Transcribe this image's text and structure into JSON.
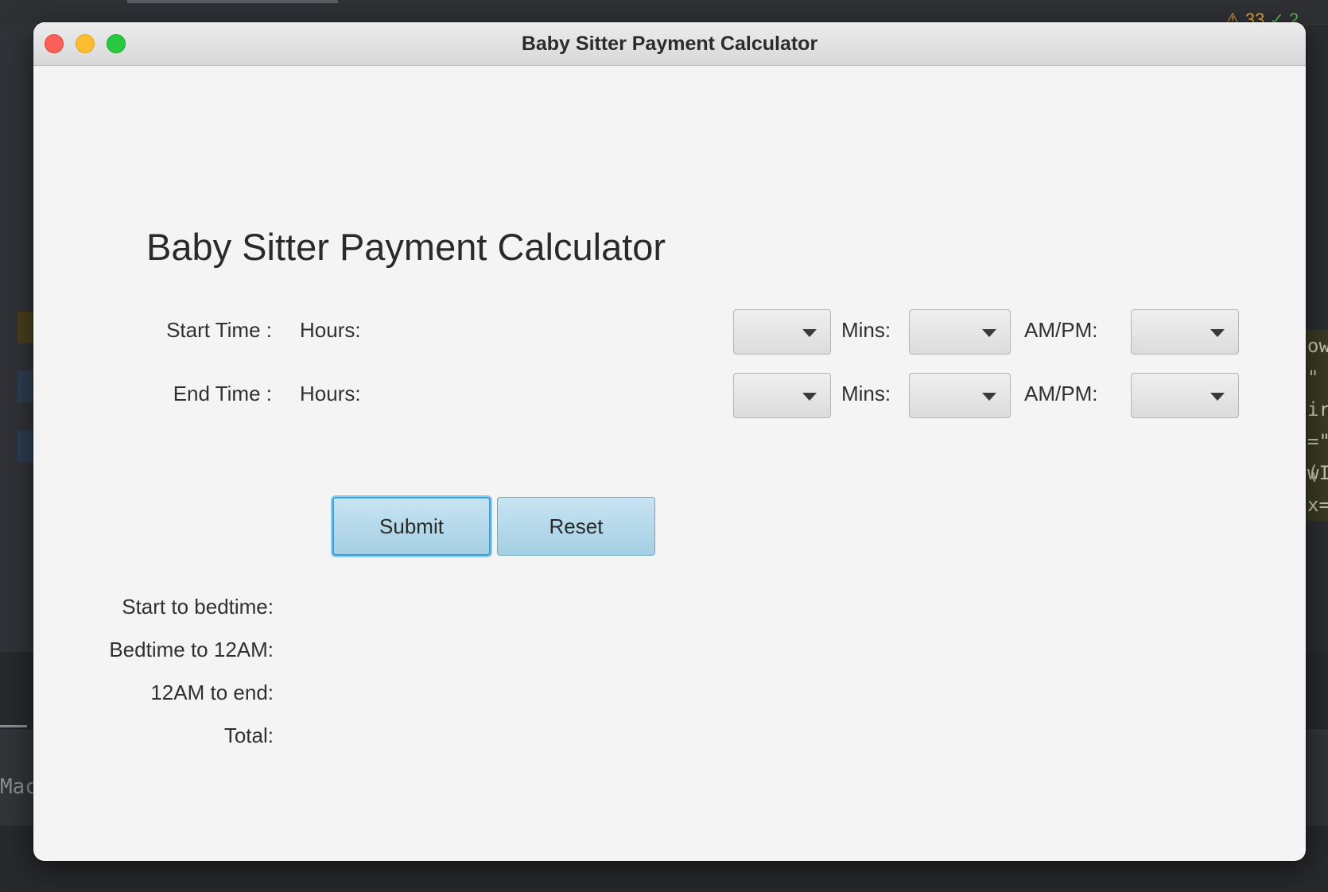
{
  "background_ide": {
    "status_warnings": "⚠ 33",
    "status_checks": "✓ 2",
    "right_panel_lines": [
      "owi",
      "\" i",
      ".re",
      "=\"(",
      "wIr",
      "x="
    ],
    "bottom_text": "Mac"
  },
  "window": {
    "title": "Baby Sitter Payment Calculator"
  },
  "form": {
    "heading": "Baby Sitter Payment Calculator",
    "start_time": {
      "label": "Start Time :",
      "hours_label": "Hours:",
      "hours_value": "",
      "mins_label": "Mins:",
      "mins_value": "",
      "ampm_label": "AM/PM:",
      "ampm_value": ""
    },
    "end_time": {
      "label": "End Time :",
      "hours_label": "Hours:",
      "hours_value": "",
      "mins_label": "Mins:",
      "mins_value": "",
      "ampm_label": "AM/PM:",
      "ampm_value": ""
    },
    "submit_label": "Submit",
    "reset_label": "Reset"
  },
  "results": {
    "start_to_bedtime_label": "Start to bedtime:",
    "bedtime_to_12am_label": "Bedtime to 12AM:",
    "twelve_am_to_end_label": "12AM to end:",
    "total_label": "Total:"
  },
  "colors": {
    "window_bg": "#f4f4f4",
    "button_fill": "#b3daea",
    "button_focus_ring": "#3aa0dd",
    "close": "#fe5f57",
    "minimize": "#febc2e",
    "maximize": "#28c840"
  }
}
